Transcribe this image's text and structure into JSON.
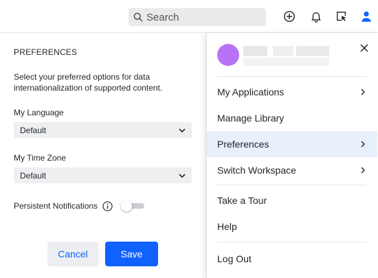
{
  "topbar": {
    "search_placeholder": "Search"
  },
  "preferences": {
    "title": "PREFERENCES",
    "description": "Select your preferred options for data internationalization of supported content.",
    "language_label": "My Language",
    "language_value": "Default",
    "timezone_label": "My Time Zone",
    "timezone_value": "Default",
    "notifications_label": "Persistent Notifications",
    "notifications_enabled": false,
    "cancel_label": "Cancel",
    "save_label": "Save"
  },
  "user_menu": {
    "items": [
      {
        "label": "My Applications",
        "has_submenu": true
      },
      {
        "label": "Manage Library",
        "has_submenu": false
      },
      {
        "label": "Preferences",
        "has_submenu": true,
        "active": true
      },
      {
        "label": "Switch Workspace",
        "has_submenu": true
      },
      {
        "label": "Take a Tour",
        "has_submenu": false
      },
      {
        "label": "Help",
        "has_submenu": false
      },
      {
        "label": "Log Out",
        "has_submenu": false
      }
    ]
  },
  "colors": {
    "accent": "#0f62fe",
    "avatar": "#b872f5",
    "active_item_bg": "#e8f0fc"
  }
}
